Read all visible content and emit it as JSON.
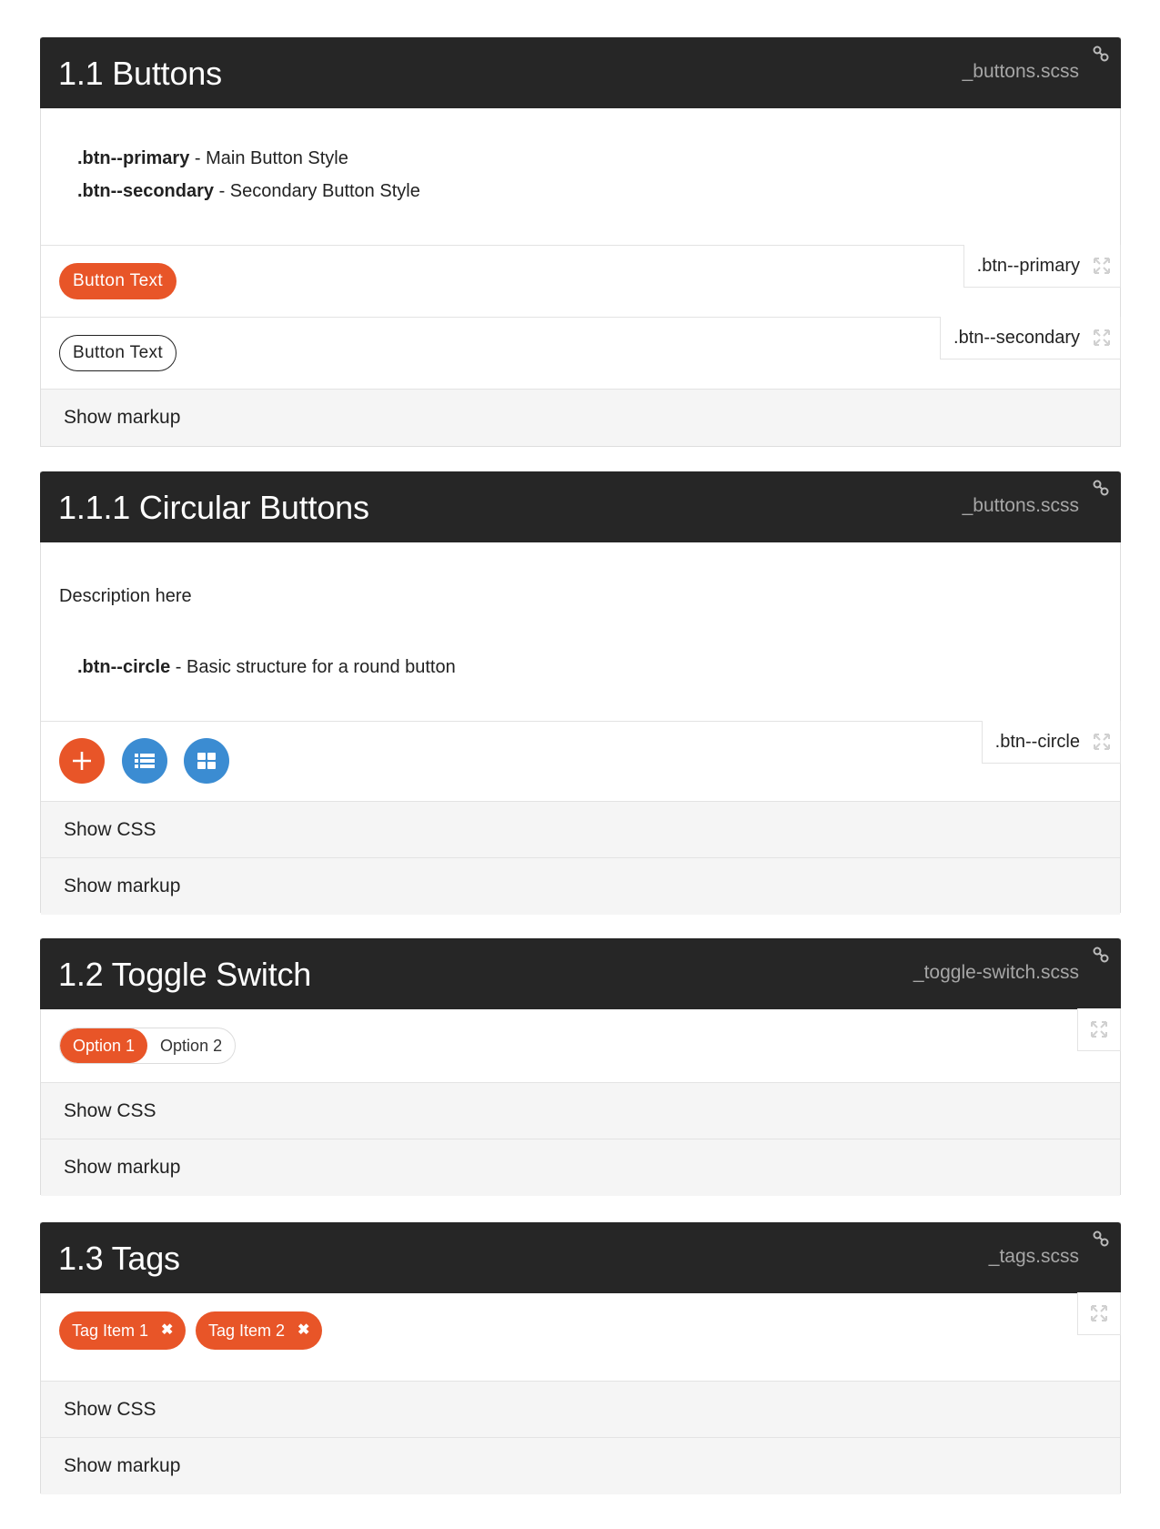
{
  "sections": [
    {
      "title": "1.1 Buttons",
      "file": "_buttons.scss",
      "modifiers": [
        {
          "name": ".btn--primary",
          "desc": " - Main Button Style"
        },
        {
          "name": ".btn--secondary",
          "desc": " - Secondary Button Style"
        }
      ],
      "examples": [
        {
          "modifier": ".btn--primary",
          "button_label": "Button Text"
        },
        {
          "modifier": ".btn--secondary",
          "button_label": "Button Text"
        }
      ],
      "show_markup": "Show markup"
    },
    {
      "title": "1.1.1 Circular Buttons",
      "file": "_buttons.scss",
      "description": "Description here",
      "modifiers": [
        {
          "name": ".btn--circle",
          "desc": " - Basic structure for a round button"
        }
      ],
      "example": {
        "modifier": ".btn--circle",
        "icons": [
          "plus-icon",
          "list-icon",
          "grid-icon"
        ]
      },
      "show_css": "Show CSS",
      "show_markup": "Show markup"
    },
    {
      "title": "1.2 Toggle Switch",
      "file": "_toggle-switch.scss",
      "options": [
        "Option 1",
        "Option 2"
      ],
      "selected": "Option 1",
      "show_css": "Show CSS",
      "show_markup": "Show markup"
    },
    {
      "title": "1.3 Tags",
      "file": "_tags.scss",
      "tags": [
        "Tag Item 1",
        "Tag Item 2"
      ],
      "tag_remove_glyph": "✖",
      "show_css": "Show CSS",
      "show_markup": "Show markup"
    }
  ],
  "colors": {
    "header_bg": "#262626",
    "accent": "#e85528",
    "circle_blue": "#3b8cd2",
    "file_text": "#a6a6a6"
  }
}
